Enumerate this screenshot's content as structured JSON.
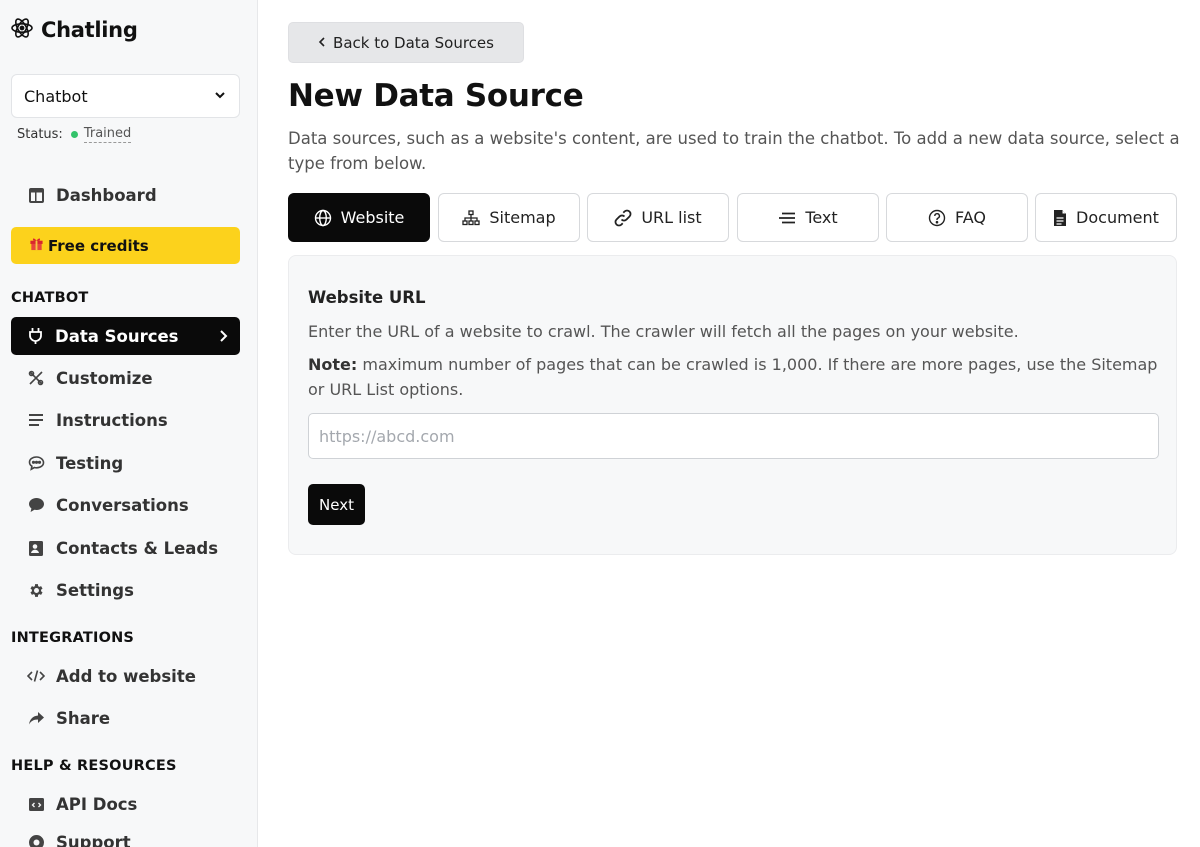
{
  "brand": {
    "name": "Chatling"
  },
  "bot_select": {
    "value": "Chatbot"
  },
  "status": {
    "label": "Status:",
    "value": "Trained",
    "color": "#33c36b"
  },
  "nav_top": {
    "dashboard": "Dashboard",
    "free_credits": "Free credits"
  },
  "sections": {
    "chatbot": "CHATBOT",
    "integrations": "INTEGRATIONS",
    "help": "HELP & RESOURCES"
  },
  "nav_chatbot": [
    {
      "label": "Data Sources",
      "icon": "plug-icon",
      "active": true
    },
    {
      "label": "Customize",
      "icon": "customize-icon"
    },
    {
      "label": "Instructions",
      "icon": "lines-icon"
    },
    {
      "label": "Testing",
      "icon": "chat-bubble-icon"
    },
    {
      "label": "Conversations",
      "icon": "comment-icon"
    },
    {
      "label": "Contacts & Leads",
      "icon": "contact-card-icon"
    },
    {
      "label": "Settings",
      "icon": "gear-icon"
    }
  ],
  "nav_integrations": [
    {
      "label": "Add to website",
      "icon": "code-icon"
    },
    {
      "label": "Share",
      "icon": "share-icon"
    }
  ],
  "nav_help": [
    {
      "label": "API Docs",
      "icon": "api-icon"
    },
    {
      "label": "Support",
      "icon": "support-icon"
    }
  ],
  "main": {
    "back_label": "Back to Data Sources",
    "title": "New Data Source",
    "description": "Data sources, such as a website's content, are used to train the chatbot. To add a new data source, select a type from below.",
    "tabs": [
      {
        "label": "Website",
        "icon": "globe-icon",
        "active": true
      },
      {
        "label": "Sitemap",
        "icon": "sitemap-icon"
      },
      {
        "label": "URL list",
        "icon": "link-icon"
      },
      {
        "label": "Text",
        "icon": "text-lines-icon"
      },
      {
        "label": "FAQ",
        "icon": "question-icon"
      },
      {
        "label": "Document",
        "icon": "document-icon"
      }
    ],
    "card": {
      "title": "Website URL",
      "description": "Enter the URL of a website to crawl. The crawler will fetch all the pages on your website.",
      "note_label": "Note:",
      "note_text": " maximum number of pages that can be crawled is 1,000. If there are more pages, use the Sitemap or URL List options.",
      "input_placeholder": "https://abcd.com",
      "input_value": "",
      "next_label": "Next"
    }
  },
  "colors": {
    "accent_black": "#0a0a0a",
    "free_credits": "#fcd21c"
  }
}
